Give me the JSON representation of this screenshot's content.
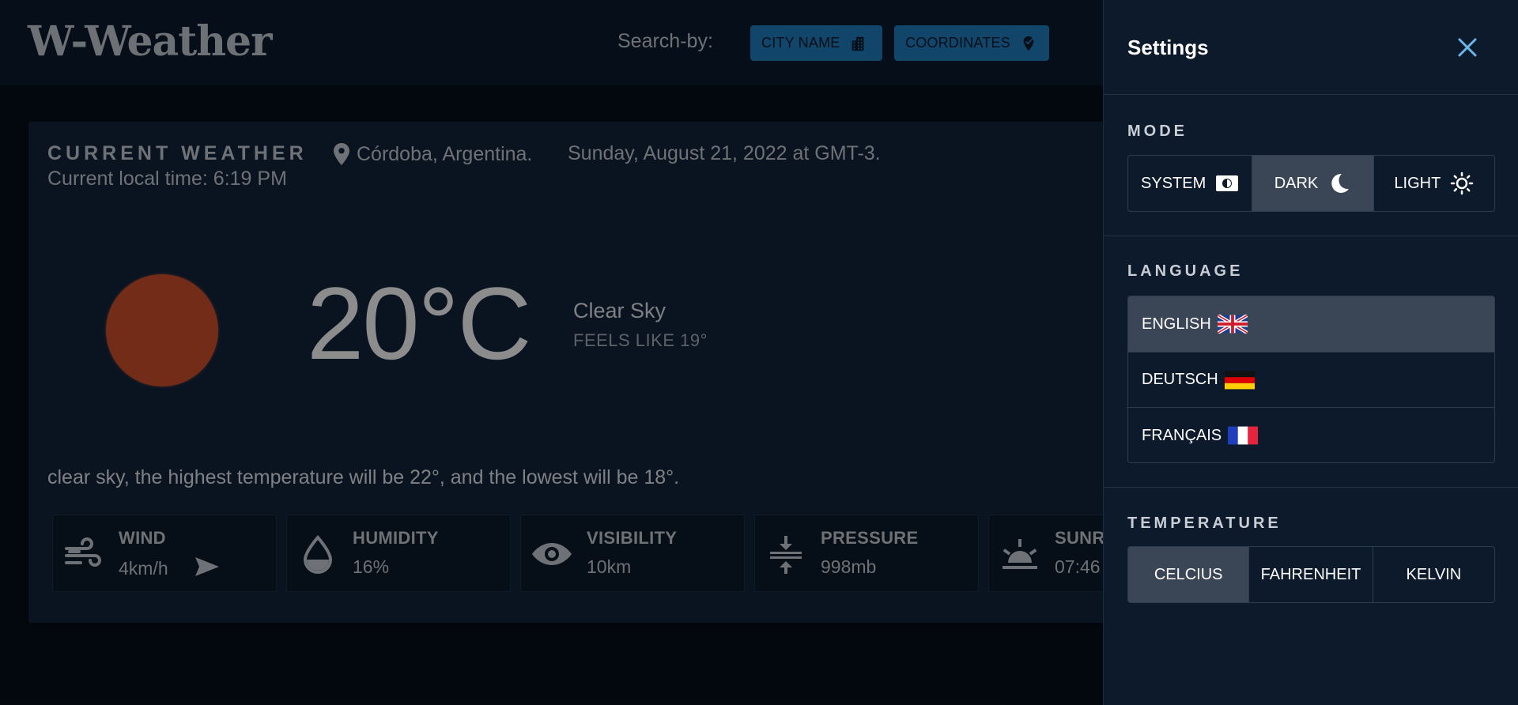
{
  "header": {
    "logo": "W-Weather",
    "search_label": "Search-by:",
    "city_button": "CITY NAME",
    "coords_button": "COORDINATES"
  },
  "weather": {
    "section_title": "CURRENT WEATHER",
    "location": "Córdoba, Argentina.",
    "date": "Sunday, August 21, 2022 at GMT-3.",
    "local_time": "Current local time: 6:19 PM",
    "temperature": "20°C",
    "sky": "Clear Sky",
    "feels_like": "FEELS LIKE 19°",
    "summary": "clear sky, the highest temperature will be 22°, and the lowest will be 18°.",
    "sun_color": "#d2502a",
    "stats": [
      {
        "label": "WIND",
        "value": "4km/h",
        "icon": "wind-icon"
      },
      {
        "label": "HUMIDITY",
        "value": "16%",
        "icon": "droplet-icon"
      },
      {
        "label": "VISIBILITY",
        "value": "10km",
        "icon": "eye-icon"
      },
      {
        "label": "PRESSURE",
        "value": "998mb",
        "icon": "pressure-icon"
      },
      {
        "label": "SUNR",
        "value": "07:46",
        "icon": "sunrise-icon"
      }
    ]
  },
  "settings": {
    "title": "Settings",
    "mode": {
      "title": "MODE",
      "options": [
        "SYSTEM",
        "DARK",
        "LIGHT"
      ],
      "selected": "DARK"
    },
    "language": {
      "title": "LANGUAGE",
      "options": [
        "ENGLISH",
        "DEUTSCH",
        "FRANÇAIS"
      ],
      "selected": "ENGLISH"
    },
    "temperature": {
      "title": "TEMPERATURE",
      "options": [
        "CELCIUS",
        "FAHRENHEIT",
        "KELVIN"
      ],
      "selected": "CELCIUS"
    }
  },
  "colors": {
    "accent": "#1f7ec2",
    "drawer_bg": "#0c1a2b",
    "active_option": "#3a4555"
  }
}
